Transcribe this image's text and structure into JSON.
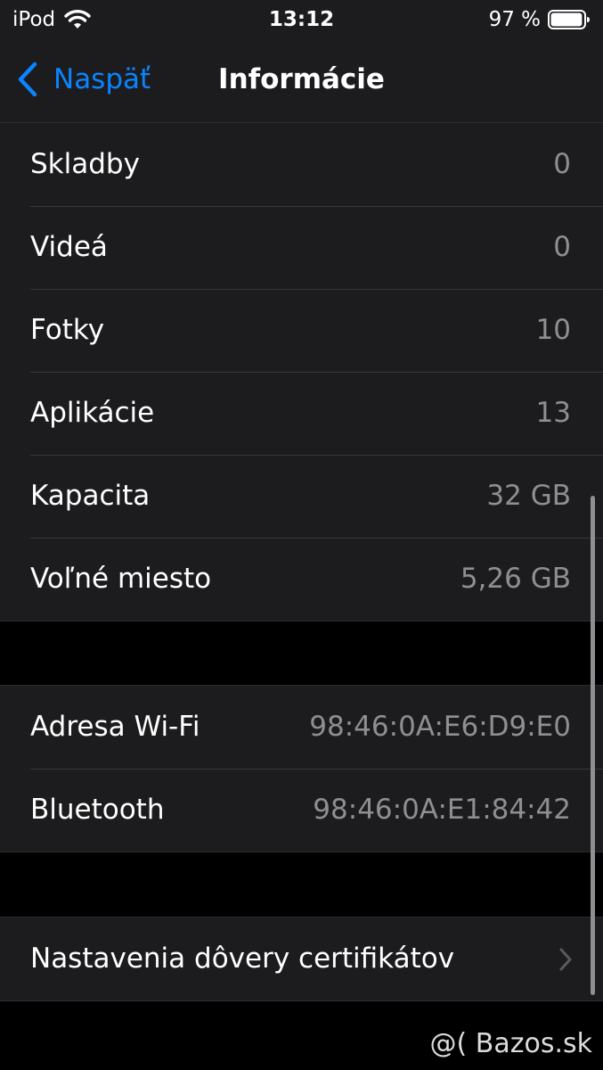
{
  "status_bar": {
    "carrier": "iPod",
    "time": "13:12",
    "battery": "97 %",
    "battery_level": 0.97
  },
  "nav": {
    "back_label": "Naspäť",
    "title": "Informácie"
  },
  "media_section": [
    {
      "label": "Skladby",
      "value": "0"
    },
    {
      "label": "Videá",
      "value": "0"
    },
    {
      "label": "Fotky",
      "value": "10"
    },
    {
      "label": "Aplikácie",
      "value": "13"
    },
    {
      "label": "Kapacita",
      "value": "32 GB"
    },
    {
      "label": "Voľné miesto",
      "value": "5,26 GB"
    }
  ],
  "network_section": [
    {
      "label": "Adresa Wi-Fi",
      "value": "98:46:0A:E6:D9:E0"
    },
    {
      "label": "Bluetooth",
      "value": "98:46:0A:E1:84:42"
    }
  ],
  "certificate_section": {
    "label": "Nastavenia dôvery certifikátov"
  },
  "watermark": "@( Bazos.sk",
  "colors": {
    "background": "#000000",
    "cell": "#1c1c1e",
    "accent": "#0a84ff",
    "secondary_text": "#8e8e93"
  },
  "icons": {
    "wifi": "wifi-icon",
    "battery": "battery-icon",
    "back": "chevron-left-icon",
    "disclosure": "chevron-right-icon"
  }
}
